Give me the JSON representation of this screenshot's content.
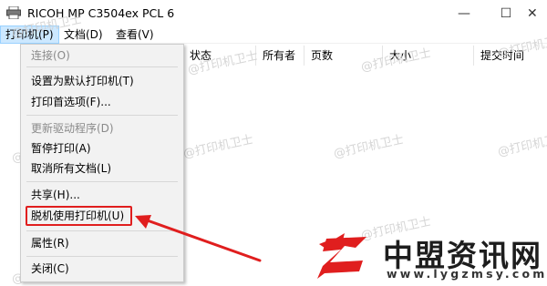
{
  "window": {
    "title": "RICOH MP C3504ex PCL 6",
    "icon": "printer-icon"
  },
  "menubar": {
    "items": [
      "打印机(P)",
      "文档(D)",
      "查看(V)"
    ]
  },
  "columns": [
    "状态",
    "所有者",
    "页数",
    "大小",
    "提交时间"
  ],
  "dropdown": {
    "items": [
      {
        "label": "连接(O)",
        "disabled": true
      },
      {
        "label": "设置为默认打印机(T)",
        "disabled": false
      },
      {
        "label": "打印首选项(F)...",
        "disabled": false
      },
      {
        "label": "更新驱动程序(D)",
        "disabled": true
      },
      {
        "label": "暂停打印(A)",
        "disabled": false
      },
      {
        "label": "取消所有文档(L)",
        "disabled": false
      },
      {
        "label": "共享(H)...",
        "disabled": false
      },
      {
        "label": "脱机使用打印机(U)",
        "disabled": false,
        "highlighted": true
      },
      {
        "label": "属性(R)",
        "disabled": false
      },
      {
        "label": "关闭(C)",
        "disabled": false
      }
    ]
  },
  "watermark_text": "@打印机卫士",
  "brand": {
    "name": "中盟资讯网",
    "url": "www.lygzmsy.com"
  },
  "colors": {
    "highlight": "#e01e1e",
    "menu_active": "#cce8ff"
  }
}
